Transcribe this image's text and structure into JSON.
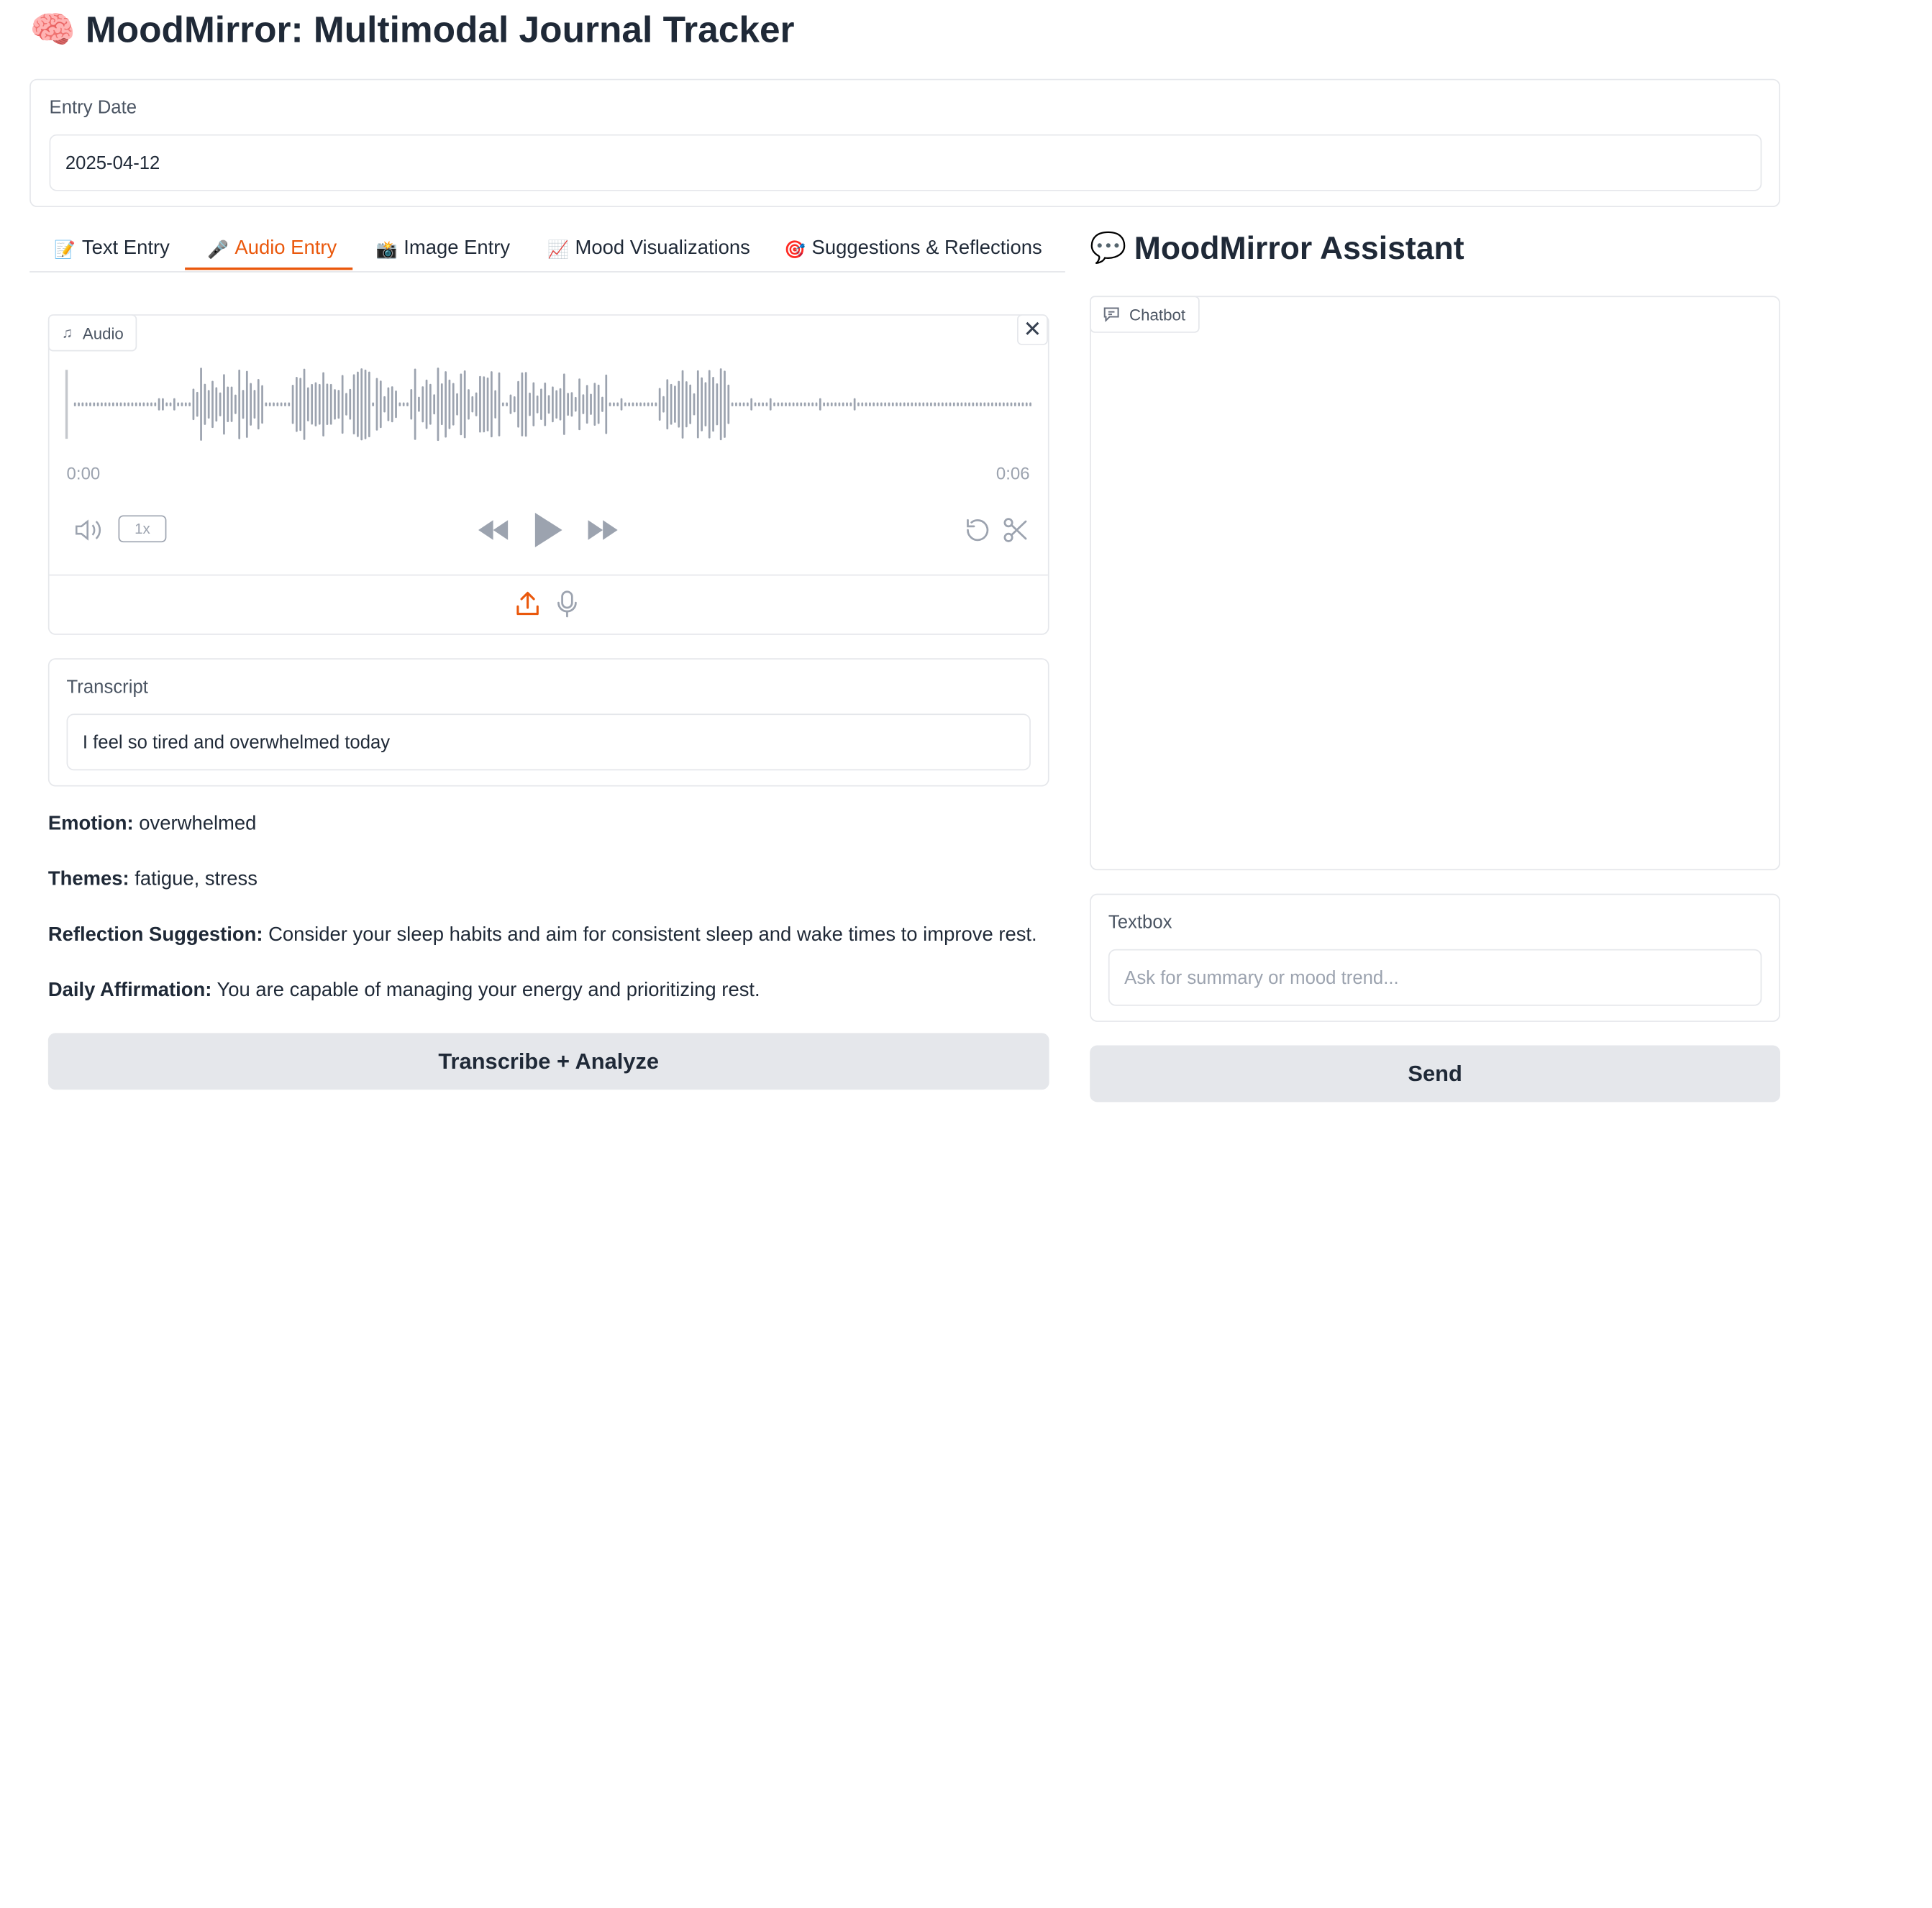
{
  "app": {
    "title": "MoodMirror: Multimodal Journal Tracker",
    "title_icon": "brain-icon"
  },
  "entry_date": {
    "label": "Entry Date",
    "value": "2025-04-12"
  },
  "tabs": [
    {
      "label": "Text Entry",
      "icon": "memo-icon",
      "glyph": "📝"
    },
    {
      "label": "Audio Entry",
      "icon": "microphone-icon",
      "glyph": "🎤",
      "active": true
    },
    {
      "label": "Image Entry",
      "icon": "camera-flash-icon",
      "glyph": "📸"
    },
    {
      "label": "Mood Visualizations",
      "icon": "chart-increasing-icon",
      "glyph": "📈"
    },
    {
      "label": "Suggestions & Reflections",
      "icon": "direct-hit-icon",
      "glyph": "🎯"
    }
  ],
  "audio": {
    "label": "Audio",
    "time_start": "0:00",
    "time_end": "0:06",
    "speed": "1x"
  },
  "transcript": {
    "label": "Transcript",
    "value": "I feel so tired and overwhelmed today"
  },
  "results": {
    "emotion_label": "Emotion:",
    "emotion_value": "overwhelmed",
    "themes_label": "Themes:",
    "themes_value": "fatigue, stress",
    "reflection_label": "Reflection Suggestion:",
    "reflection_value": "Consider your sleep habits and aim for consistent sleep and wake times to improve rest.",
    "affirmation_label": "Daily Affirmation:",
    "affirmation_value": "You are capable of managing your energy and prioritizing rest."
  },
  "analyze_button": "Transcribe + Analyze",
  "assistant": {
    "title": "MoodMirror Assistant",
    "title_icon": "speech-bubble-icon",
    "chatbot_label": "Chatbot",
    "textbox_label": "Textbox",
    "textbox_placeholder": "Ask for summary or mood trend...",
    "send_button": "Send"
  },
  "colors": {
    "accent": "#ea580c",
    "button_bg": "#e5e7eb",
    "border": "#e5e7eb",
    "muted": "#9ca3af"
  }
}
